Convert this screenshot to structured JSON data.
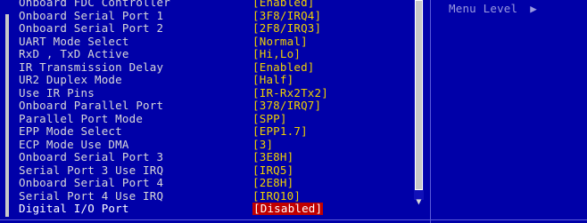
{
  "settings": [
    {
      "label": "Onboard FDC Controller",
      "value": "[Enabled]"
    },
    {
      "label": "Onboard Serial Port 1",
      "value": "[3F8/IRQ4]"
    },
    {
      "label": "Onboard Serial Port 2",
      "value": "[2F8/IRQ3]"
    },
    {
      "label": "UART Mode Select",
      "value": "[Normal]"
    },
    {
      "label": "RxD , TxD Active",
      "value": "[Hi,Lo]"
    },
    {
      "label": "IR Transmission Delay",
      "value": "[Enabled]"
    },
    {
      "label": "UR2 Duplex Mode",
      "value": "[Half]"
    },
    {
      "label": "Use IR Pins",
      "value": "[IR-Rx2Tx2]"
    },
    {
      "label": "Onboard Parallel Port",
      "value": "[378/IRQ7]"
    },
    {
      "label": "Parallel Port Mode",
      "value": "[SPP]"
    },
    {
      "label": "EPP Mode Select",
      "value": "[EPP1.7]"
    },
    {
      "label": "ECP Mode Use DMA",
      "value": "[3]"
    },
    {
      "label": "Onboard Serial Port 3",
      "value": "[3E8H]"
    },
    {
      "label": "Serial Port 3 Use IRQ",
      "value": "[IRQ5]"
    },
    {
      "label": "Onboard Serial Port 4",
      "value": "[2E8H]"
    },
    {
      "label": "Serial Port 4 Use IRQ",
      "value": "[IRQ10]"
    },
    {
      "label": "Digital I/O Port",
      "value": "[Disabled]"
    }
  ],
  "selected_index": 16,
  "help": {
    "menu_level_label": "Menu Level",
    "menu_level_arrow": "▶"
  },
  "scrollbar": {
    "down_arrow": "▼",
    "position": 0.0
  },
  "colors": {
    "background": "#0000a8",
    "label_text": "#d8d8d8",
    "value_text": "#f0d000",
    "highlight_bg": "#c00000",
    "help_text": "#9a9ae0"
  }
}
